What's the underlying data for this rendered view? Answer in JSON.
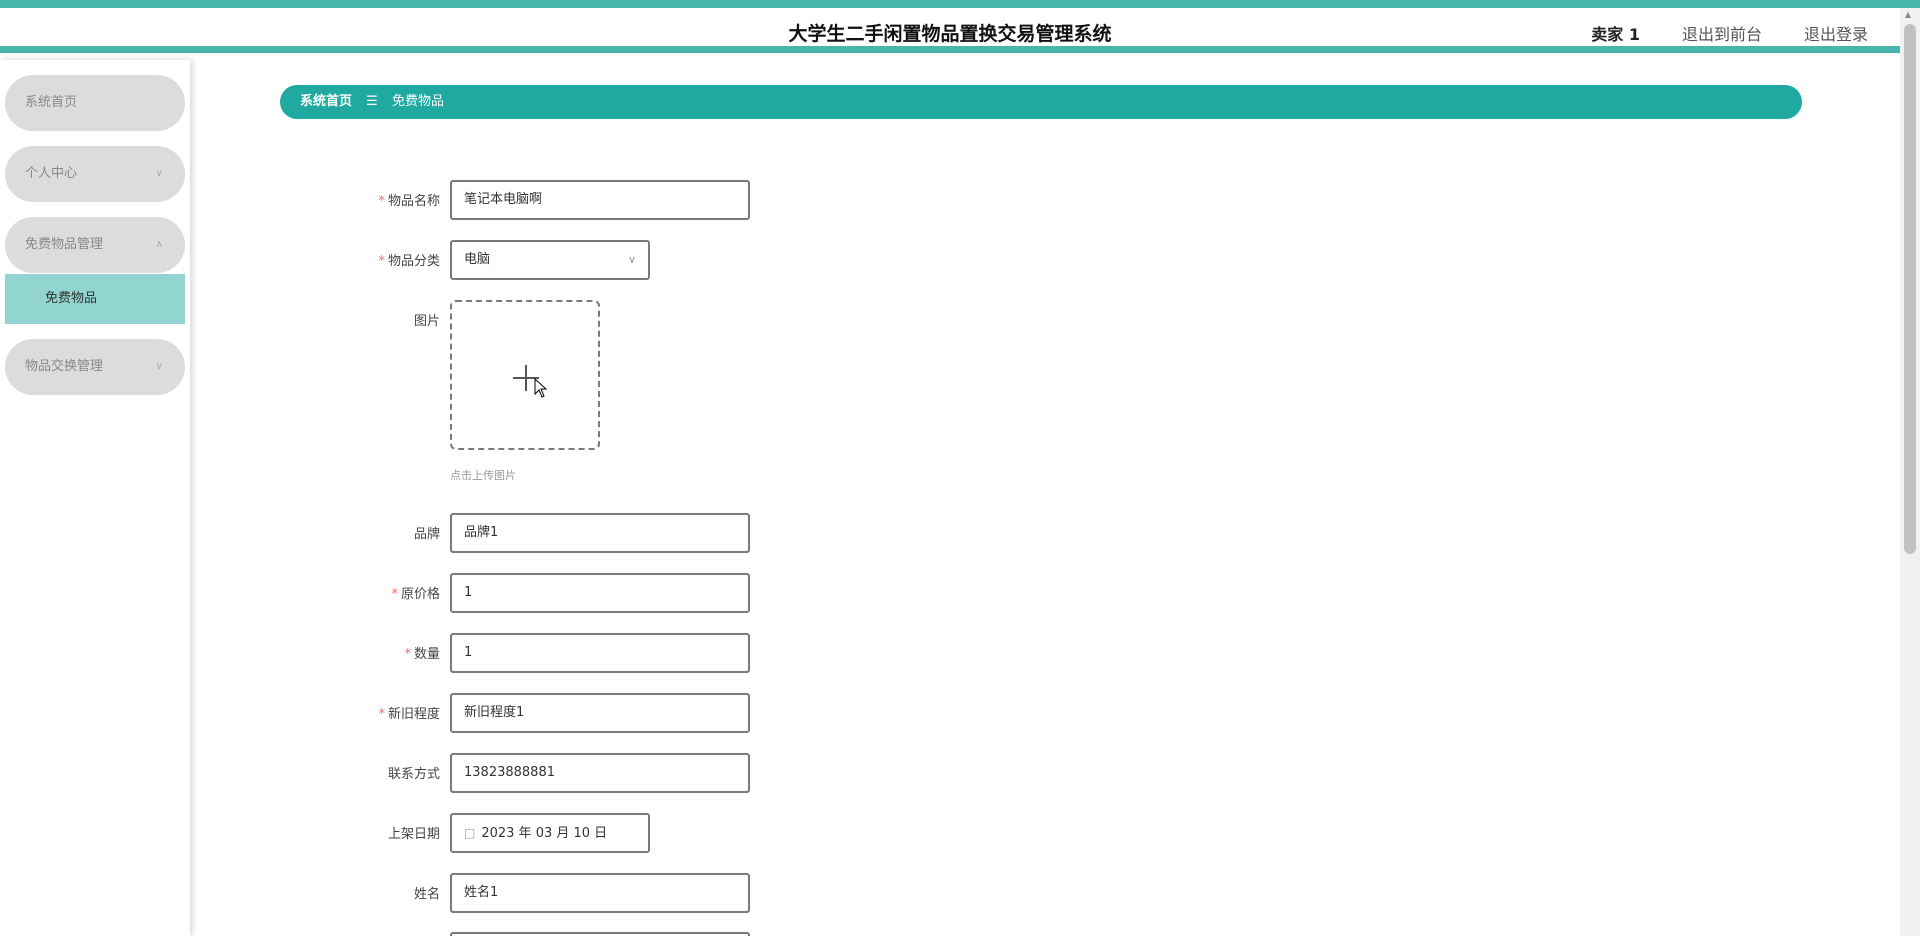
{
  "header": {
    "title": "大学生二手闲置物品置换交易管理系统",
    "user": "卖家 1",
    "front_link": "退出到前台",
    "logout_link": "退出登录"
  },
  "sidebar": {
    "home": "系统首页",
    "personal": "个人中心",
    "free_mgmt": "免费物品管理",
    "free_items": "免费物品",
    "exchange_mgmt": "物品交换管理"
  },
  "breadcrumb": {
    "home": "系统首页",
    "separator": "☰",
    "current": "免费物品"
  },
  "form": {
    "name": {
      "label": "物品名称",
      "value": "笔记本电脑啊"
    },
    "category": {
      "label": "物品分类",
      "value": "电脑"
    },
    "image": {
      "label": "图片",
      "hint": "点击上传图片"
    },
    "brand": {
      "label": "品牌",
      "value": "品牌1"
    },
    "price": {
      "label": "原价格",
      "value": "1"
    },
    "quantity": {
      "label": "数量",
      "value": "1"
    },
    "condition": {
      "label": "新旧程度",
      "value": "新旧程度1"
    },
    "contact": {
      "label": "联系方式",
      "value": "13823888881"
    },
    "date": {
      "label": "上架日期",
      "value": "2023 年 03 月 10 日"
    },
    "person": {
      "label": "姓名",
      "value": "姓名1"
    }
  },
  "required_marker": "*",
  "colors": {
    "accent": "#1fa9a1",
    "stripe": "#48b5ad",
    "submenu_active": "#91d4d0",
    "required": "#f56c6c"
  },
  "icons": {
    "chevron_down": "chevron-down-icon",
    "chevron_up": "chevron-up-icon",
    "calendar": "calendar-icon",
    "plus": "plus-icon"
  }
}
